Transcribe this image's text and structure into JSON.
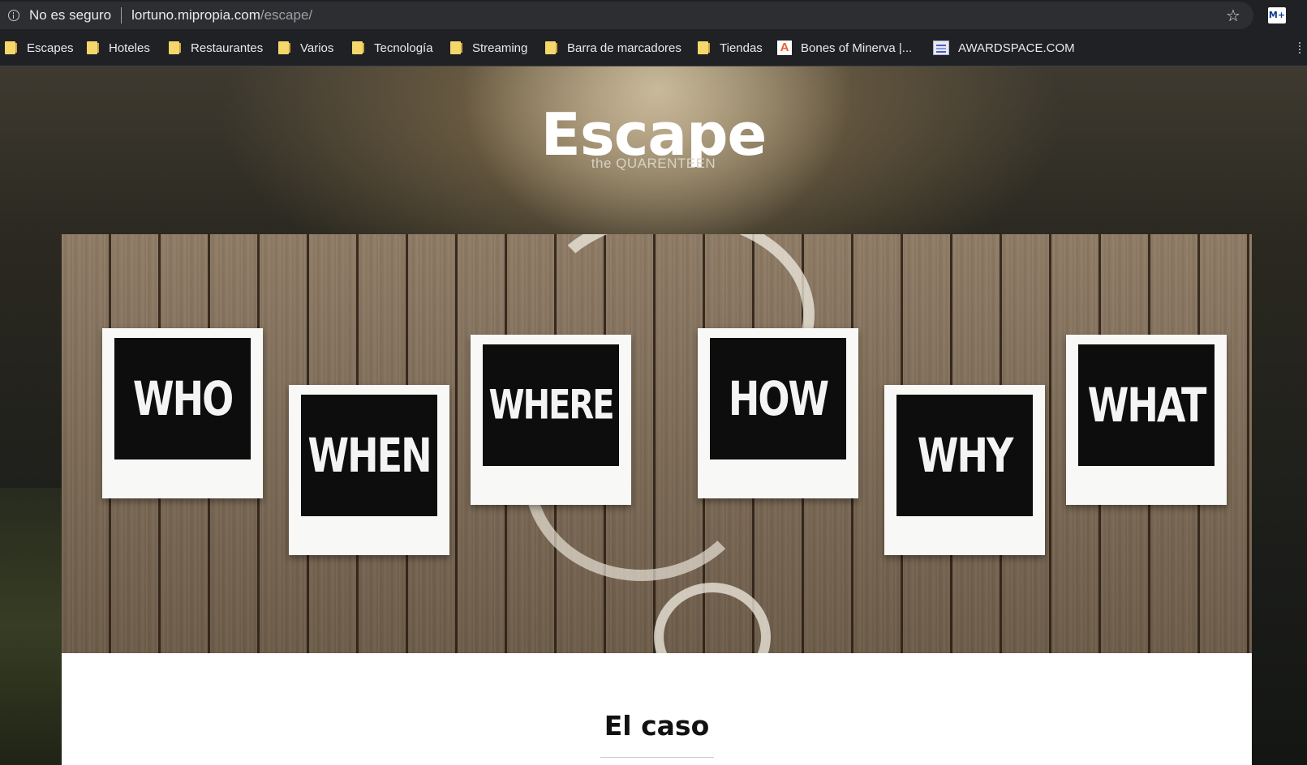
{
  "browser": {
    "security_label": "No es seguro",
    "url_host": "lortuno.mipropia.com",
    "url_path": "/escape/",
    "extension_label": "M+",
    "bookmarks": [
      {
        "label": "Escapes",
        "icon": "folder-icon"
      },
      {
        "label": "Hoteles",
        "icon": "folder-icon"
      },
      {
        "label": "Restaurantes",
        "icon": "folder-icon"
      },
      {
        "label": "Varios",
        "icon": "folder-icon"
      },
      {
        "label": "Tecnología",
        "icon": "folder-icon"
      },
      {
        "label": "Streaming",
        "icon": "folder-icon"
      },
      {
        "label": "Barra de marcadores",
        "icon": "folder-icon"
      },
      {
        "label": "Tiendas",
        "icon": "folder-icon"
      },
      {
        "label": "Bones of Minerva |...",
        "icon": "site-favicon-icon"
      },
      {
        "label": "AWARDSPACE.COM",
        "icon": "site-favicon-icon"
      }
    ]
  },
  "hero": {
    "title": "Escape",
    "subtitle": "the QUARENTEEN"
  },
  "banner": {
    "words": [
      "WHO",
      "WHEN",
      "WHERE",
      "HOW",
      "WHY",
      "WHAT"
    ]
  },
  "content": {
    "section_title": "El caso"
  },
  "colors": {
    "chrome_bg": "#202124",
    "omnibox_bg": "#2d2e31",
    "folder": "#f6d76b",
    "card_bg": "#ffffff"
  }
}
